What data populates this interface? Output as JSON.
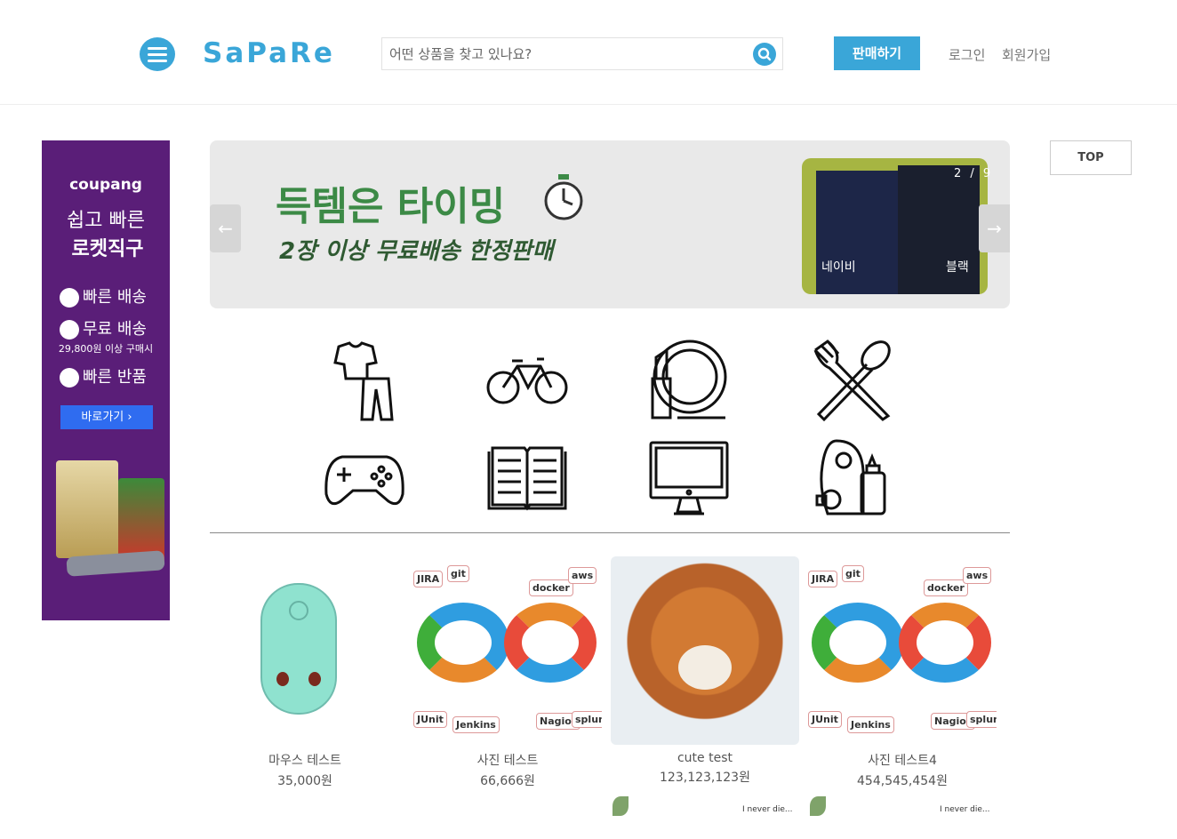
{
  "header": {
    "logo": "SaPaRe",
    "search_placeholder": "어떤 상품을 찾고 있나요?",
    "sell_label": "판매하기",
    "login_label": "로그인",
    "signup_label": "회원가입",
    "accent_color": "#3aa6d8"
  },
  "top_button": "TOP",
  "side_ad": {
    "brand": "coupang",
    "line1": "쉽고 빠른",
    "line2": "로켓직구",
    "features": [
      "빠른 배송",
      "무료 배송",
      "빠른 반품"
    ],
    "free_shipping_note": "29,800원 이상 구매시",
    "cta": "바로가기"
  },
  "banner": {
    "headline": "득템은 타이밍",
    "subline": "2장 이상 무료배송 한정판매",
    "photo_labels": [
      "네이비",
      "블랙"
    ],
    "counter": "2 / 9",
    "prev_label": "←",
    "next_label": "→"
  },
  "categories": [
    {
      "name": "clothing",
      "icon": "clothing-icon"
    },
    {
      "name": "bicycle",
      "icon": "bicycle-icon"
    },
    {
      "name": "cosmetics",
      "icon": "cosmetics-icon"
    },
    {
      "name": "kitchen",
      "icon": "fork-spoon-icon"
    },
    {
      "name": "games",
      "icon": "gamepad-icon"
    },
    {
      "name": "books",
      "icon": "book-icon"
    },
    {
      "name": "electronics",
      "icon": "monitor-icon"
    },
    {
      "name": "baby",
      "icon": "baby-bottle-icon"
    }
  ],
  "products": [
    {
      "name": "마우스 테스트",
      "price": "35,000원"
    },
    {
      "name": "사진 테스트",
      "price": "66,666원"
    },
    {
      "name": "cute test",
      "price": "123,123,123원"
    },
    {
      "name": "사진 테스트4",
      "price": "454,545,454원"
    }
  ],
  "devops_tags": [
    "JIRA",
    "git",
    "docker",
    "aws",
    "JUnit",
    "Jenkins",
    "Nagios",
    "splunk"
  ],
  "mouse_thumb_label": "",
  "cartoon_note": "I never die..."
}
